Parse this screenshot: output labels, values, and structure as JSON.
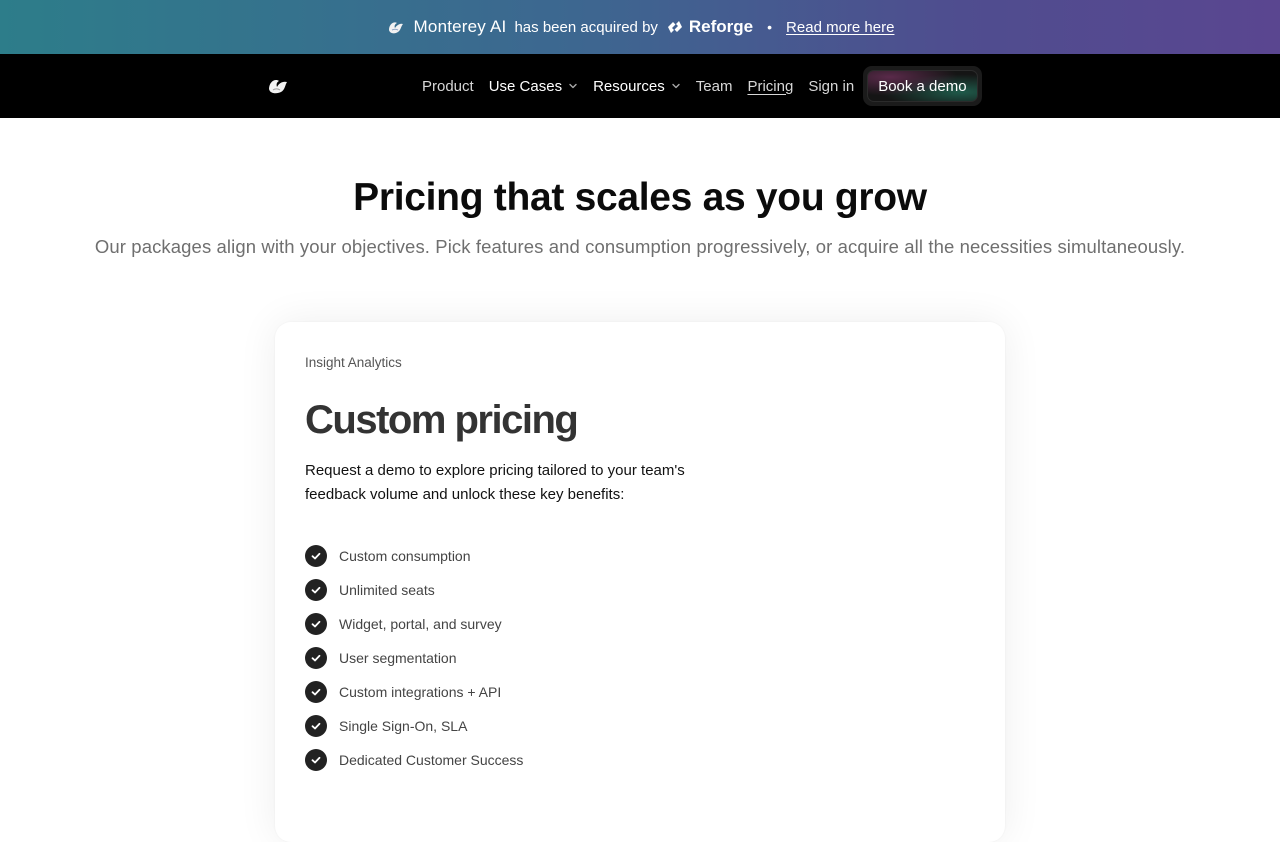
{
  "announcement": {
    "brand_name": "Monterey AI",
    "middle_text": "has been acquired by",
    "acquirer": "Reforge",
    "separator": "•",
    "link_label": "Read more here",
    "gradient": [
      "#2d7d8a",
      "#3f5a8f",
      "#5a4690"
    ]
  },
  "nav": {
    "logo_icon": "bird-logo-icon",
    "items": [
      {
        "label": "Product",
        "has_dropdown": false
      },
      {
        "label": "Use Cases",
        "has_dropdown": true
      },
      {
        "label": "Resources",
        "has_dropdown": true
      },
      {
        "label": "Team",
        "has_dropdown": false
      },
      {
        "label": "Pricing",
        "has_dropdown": false,
        "active": true
      },
      {
        "label": "Sign in",
        "has_dropdown": false
      }
    ],
    "cta_label": "Book a demo"
  },
  "hero": {
    "title": "Pricing that scales as you grow",
    "subtitle": "Our packages align with your objectives. Pick features and consumption progressively, or acquire all the necessities simultaneously."
  },
  "plan": {
    "name": "Insight Analytics",
    "price": "Custom pricing",
    "description": "Request a demo to explore pricing tailored to your team's feedback volume and unlock these key benefits:",
    "features": [
      "Custom consumption",
      "Unlimited seats",
      "Widget, portal, and survey",
      "User segmentation",
      "Custom integrations + API",
      "Single Sign-On, SLA",
      "Dedicated Customer Success"
    ],
    "feature_icon": "check-circle-icon"
  }
}
